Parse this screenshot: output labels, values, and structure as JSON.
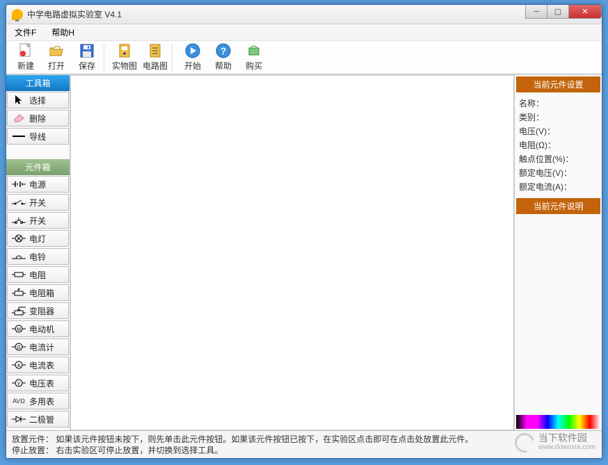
{
  "window": {
    "title": "中学电路虚拟实验室 V4.1"
  },
  "menu": {
    "file": "文件F",
    "help": "帮助H"
  },
  "toolbar": {
    "new": "新建",
    "open": "打开",
    "save": "保存",
    "real_view": "实物图",
    "circuit_view": "电路图",
    "start": "开始",
    "help": "帮助",
    "buy": "购买"
  },
  "left": {
    "toolbox_header": "工具箱",
    "tools": {
      "select": "选择",
      "delete": "删除",
      "wire": "导线"
    },
    "componentbox_header": "元件箱",
    "components": {
      "power": "电源",
      "switch1": "开关",
      "switch2": "开关",
      "lamp": "电灯",
      "bell": "电铃",
      "resistor": "电阻",
      "resbox": "电阻箱",
      "rheostat": "变阻器",
      "motor": "电动机",
      "galvanometer": "电流计",
      "ammeter": "电流表",
      "voltmeter": "电压表",
      "multimeter": "多用表",
      "diode": "二极管"
    },
    "component_syms": {
      "multimeter": "AVΩ"
    }
  },
  "right": {
    "settings_header": "当前元件设置",
    "desc_header": "当前元件说明",
    "props": {
      "name": "名称：",
      "type": "类别：",
      "voltage": "电压(V)：",
      "resistance": "电阻(Ω)：",
      "contact": "触点位置(%)：",
      "rated_v": "额定电压(V)：",
      "rated_a": "额定电流(A)："
    }
  },
  "status": {
    "line1": "放置元件：  如果该元件按钮未按下，则先单击此元件按钮。如果该元件按钮已按下，在实验区点击即可在点击处放置此元件。",
    "line2": "停止放置：  右击实验区可停止放置，并切换到选择工具。"
  },
  "watermark": {
    "name": "当下软件园",
    "url": "www.downxia.com"
  }
}
